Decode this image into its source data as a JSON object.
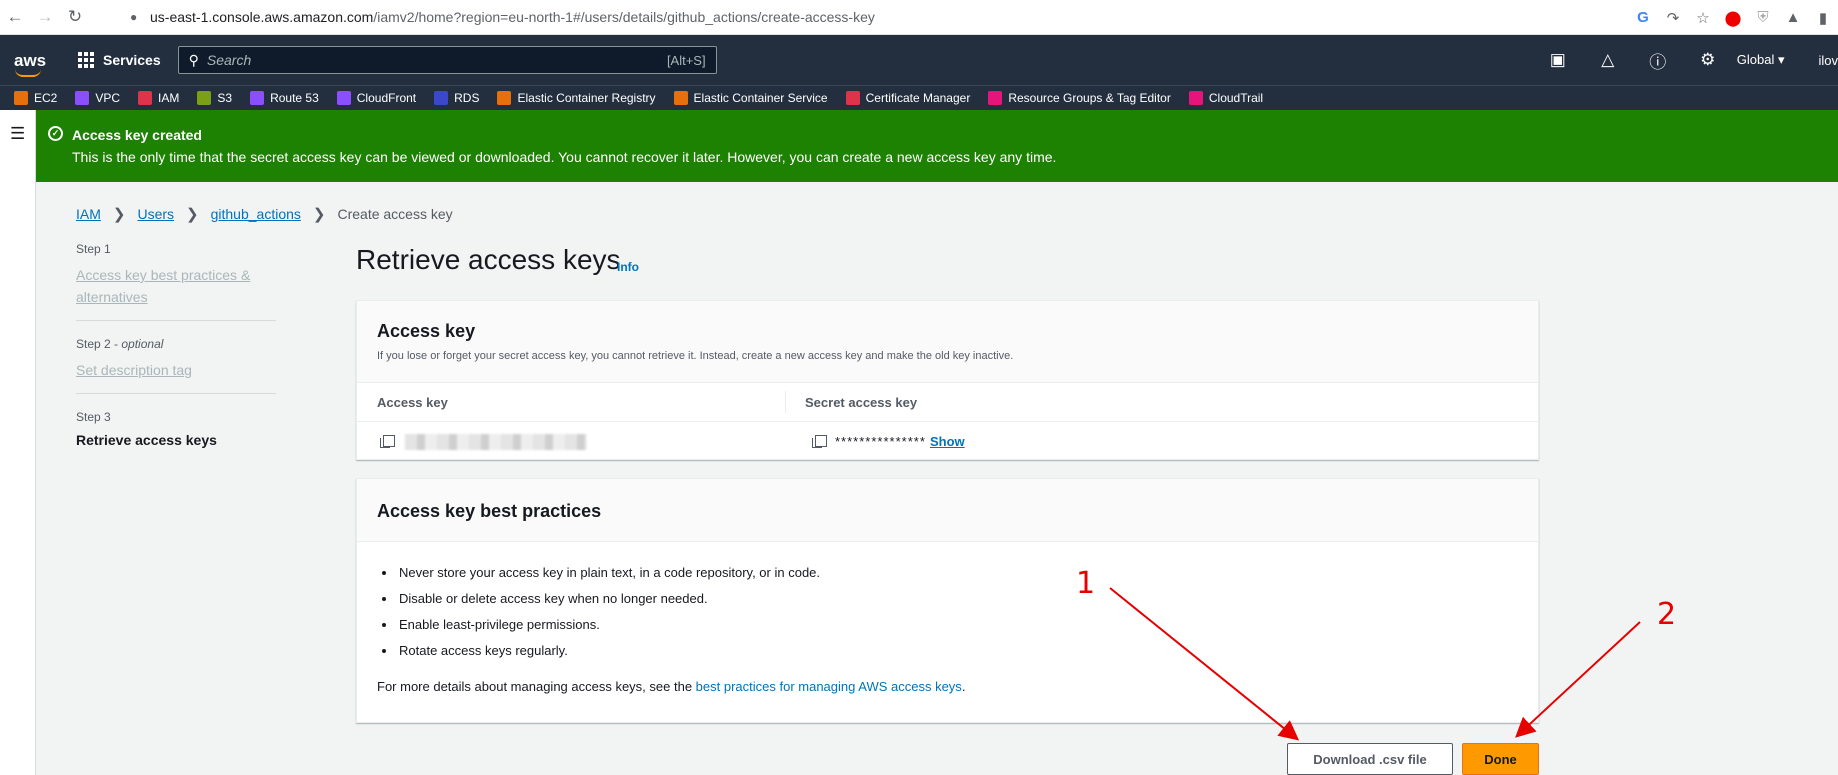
{
  "browser": {
    "url_host": "us-east-1.console.aws.amazon.com",
    "url_path": "/iamv2/home?region=eu-north-1#/users/details/github_actions/create-access-key",
    "nav_icons": [
      "back-icon",
      "forward-icon",
      "reload-icon"
    ],
    "toolbar_icons": [
      "google-icon",
      "share-icon",
      "bookmark-star-icon",
      "adblock-icon",
      "shield-extension-icon",
      "extensions-puzzle-icon",
      "sidepanel-icon"
    ]
  },
  "aws_header": {
    "logo": "aws",
    "services_label": "Services",
    "search_placeholder": "Search",
    "search_shortcut": "[Alt+S]",
    "region": "Global ▾",
    "user": "ilov"
  },
  "favorites": [
    {
      "label": "EC2",
      "color": "#e7700d"
    },
    {
      "label": "VPC",
      "color": "#8c4fff"
    },
    {
      "label": "IAM",
      "color": "#dd344c"
    },
    {
      "label": "S3",
      "color": "#7aa116"
    },
    {
      "label": "Route 53",
      "color": "#8c4fff"
    },
    {
      "label": "CloudFront",
      "color": "#8c4fff"
    },
    {
      "label": "RDS",
      "color": "#3b48cc"
    },
    {
      "label": "Elastic Container Registry",
      "color": "#e7700d"
    },
    {
      "label": "Elastic Container Service",
      "color": "#e7700d"
    },
    {
      "label": "Certificate Manager",
      "color": "#dd344c"
    },
    {
      "label": "Resource Groups & Tag Editor",
      "color": "#e7157b"
    },
    {
      "label": "CloudTrail",
      "color": "#e7157b"
    }
  ],
  "flash": {
    "title": "Access key created",
    "message": "This is the only time that the secret access key can be viewed or downloaded. You cannot recover it later. However, you can create a new access key any time.",
    "color": "#1d8102"
  },
  "breadcrumb": {
    "items": [
      "IAM",
      "Users",
      "github_actions"
    ],
    "current": "Create access key"
  },
  "steps": {
    "step1": {
      "label": "Step 1",
      "title": "Access key best practices & alternatives"
    },
    "step2": {
      "label": "Step 2",
      "optional": "optional",
      "title": "Set description tag"
    },
    "step3": {
      "label": "Step 3",
      "title": "Retrieve access keys"
    }
  },
  "page": {
    "title": "Retrieve access keys",
    "info": "Info"
  },
  "access_key_panel": {
    "title": "Access key",
    "description": "If you lose or forget your secret access key, you cannot retrieve it. Instead, create a new access key and make the old key inactive.",
    "col_access_key": "Access key",
    "col_secret_key": "Secret access key",
    "secret_mask": "***************",
    "show_label": "Show"
  },
  "best_practices_panel": {
    "title": "Access key best practices",
    "bullets": [
      "Never store your access key in plain text, in a code repository, or in code.",
      "Disable or delete access key when no longer needed.",
      "Enable least-privilege permissions.",
      "Rotate access keys regularly."
    ],
    "more_prefix": "For more details about managing access keys, see the ",
    "more_link": "best practices for managing AWS access keys",
    "more_suffix": "."
  },
  "actions": {
    "download_label": "Download .csv file",
    "done_label": "Done"
  },
  "annotations": {
    "label_1": "1",
    "label_2": "2",
    "color": "#e60000"
  },
  "colors": {
    "aws_nav": "#232f3e",
    "accent_orange": "#ff9900",
    "link_blue": "#0073bb"
  }
}
